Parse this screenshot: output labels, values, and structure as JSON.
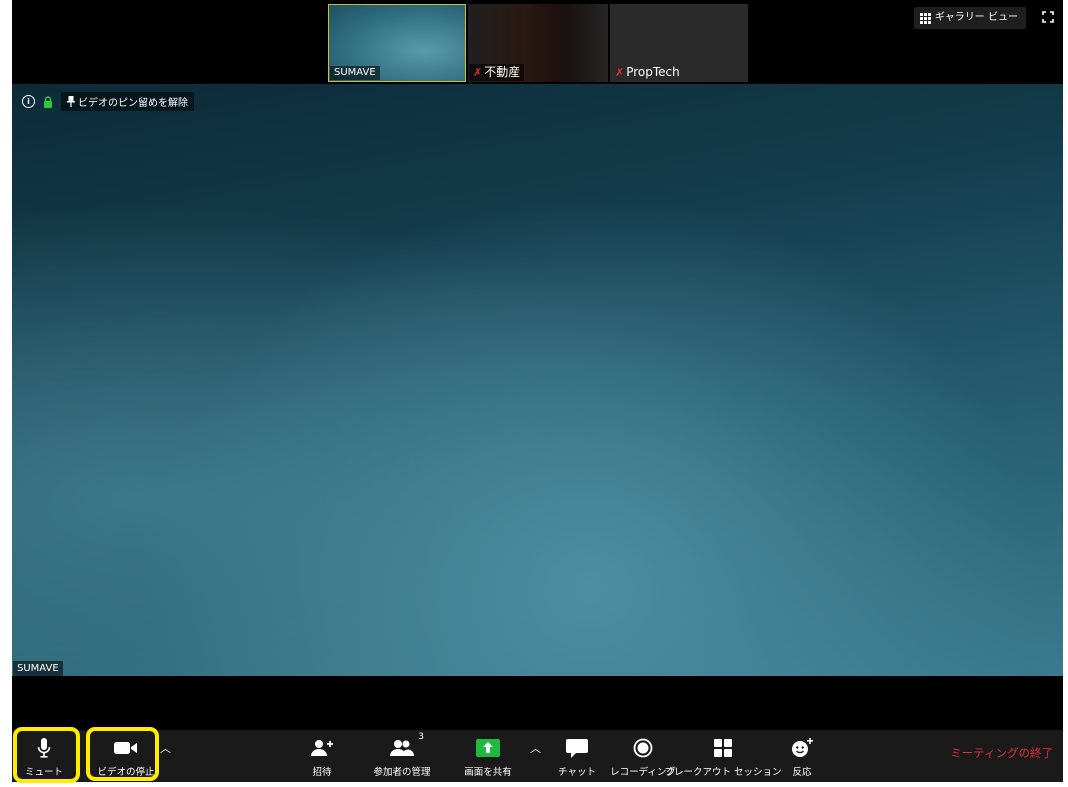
{
  "thumbnails": [
    {
      "name": "SUMAVE",
      "muted": false,
      "bg": "#3a7c8f"
    },
    {
      "name": "不動産",
      "muted": true,
      "bg": "#1e1a17"
    },
    {
      "name": "PropTech",
      "muted": true,
      "bg": "#2a2a2a"
    }
  ],
  "top_right": {
    "gallery_label": "ギャラリー ビュー",
    "gallery_icon": "grid-icon",
    "fullscreen_icon": "fullscreen-icon"
  },
  "main_video": {
    "unpin_label": "ビデオのピン留めを解除",
    "speaker_name": "SUMAVE",
    "info_icon": "info-icon",
    "lock_icon": "lock-icon"
  },
  "toolbar": {
    "mute": "ミュート",
    "stop_video": "ビデオの停止",
    "invite": "招待",
    "participants": "参加者の管理",
    "participants_count": "3",
    "share": "画面を共有",
    "chat": "チャット",
    "record": "レコーディング",
    "breakout": "ブレークアウト セッション",
    "reactions": "反応",
    "end": "ミーティングの終了"
  },
  "colors": {
    "highlight": "#ffec00",
    "end_red": "#e0303b",
    "share_green": "#1dbb40"
  }
}
